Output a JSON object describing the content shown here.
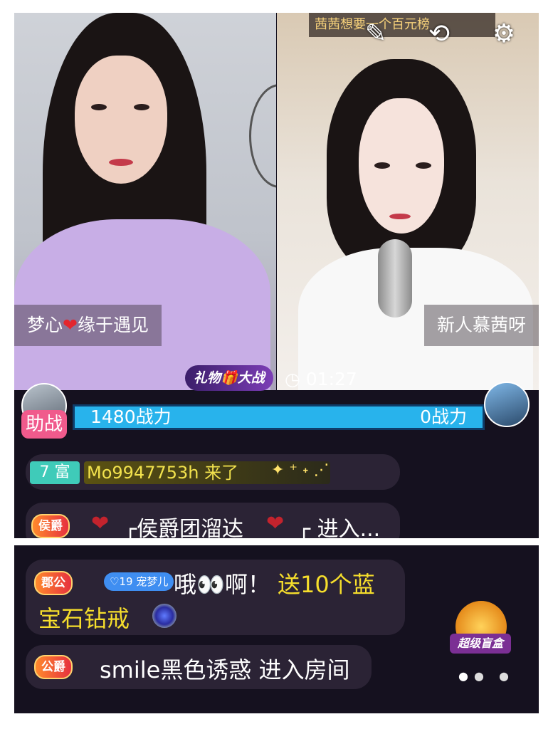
{
  "top_banner": "茜茜想要一个百元榜",
  "streamers": {
    "left": {
      "name_a": "梦心",
      "name_b": "缘于遇见"
    },
    "right": {
      "name": "新人慕茜呀"
    }
  },
  "icons": {
    "magic": "magic-wand-icon",
    "flip": "camera-flip-icon",
    "settings": "gear-icon"
  },
  "battle": {
    "label_a": "礼物",
    "label_b": "大战",
    "timer": "01:27",
    "assist_label": "助战",
    "left_power": "1480战力",
    "right_power": "0战力"
  },
  "chat": {
    "join": {
      "rich_level": "7 富",
      "text": "Mo9947753h 来了",
      "sparkle": "✦ ⁺ ˖ ⋰"
    },
    "marquis": {
      "badge": "侯爵",
      "text_a": "┌侯爵团溜达",
      "text_b": "┌ 进入..."
    },
    "gift": {
      "rank": "郡公",
      "user_badge": "宠梦儿",
      "user_level": "19",
      "text": "哦👀啊！",
      "gift_text": "送10个蓝",
      "gift_text2": "宝石钻戒"
    },
    "enter": {
      "rank": "公爵",
      "text": "smile黑色诱惑 进入房间"
    }
  },
  "blind_box": {
    "label": "超级盲盒"
  },
  "pager": {
    "active": "●",
    "inactive": "● ●"
  },
  "colors": {
    "chat_bg": "#15111f",
    "power_bar": "#28b3ec",
    "rank_badge": "#e6303f",
    "assist": "#f05a8c"
  }
}
